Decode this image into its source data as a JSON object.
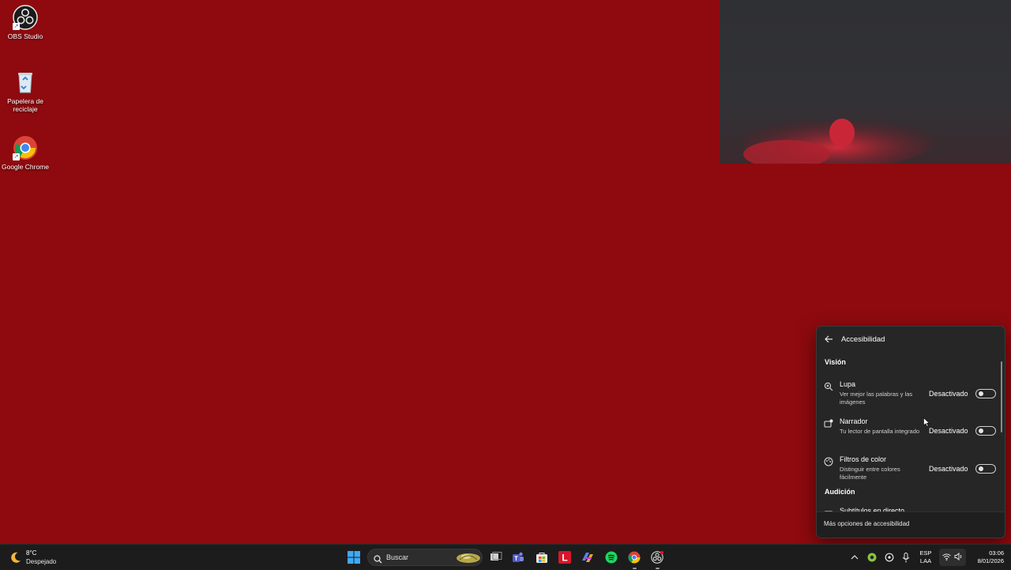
{
  "desktop": {
    "icons": [
      {
        "label": "OBS Studio",
        "icon": "obs-icon"
      },
      {
        "label": "Papelera de reciclaje",
        "icon": "recycle-bin-icon"
      },
      {
        "label": "Google Chrome",
        "icon": "chrome-icon"
      }
    ],
    "background_color": "#8e0a0e"
  },
  "flyout": {
    "title": "Accesibilidad",
    "sections": {
      "vision": "Visión",
      "audition": "Audición"
    },
    "items": [
      {
        "name": "Lupa",
        "desc": "Ver mejor las palabras y las imágenes",
        "state": "Desactivado",
        "on": false,
        "icon": "magnifier-icon"
      },
      {
        "name": "Narrador",
        "desc": "Tu lector de pantalla integrado",
        "state": "Desactivado",
        "on": false,
        "icon": "narrator-icon"
      },
      {
        "name": "Filtros de color",
        "desc": "Distinguir entre colores fácilmente",
        "state": "Desactivado",
        "on": false,
        "icon": "color-filter-icon"
      },
      {
        "name": "Subtítulos en directo",
        "icon": "captions-icon"
      }
    ],
    "footer_link": "Más opciones de accesibilidad"
  },
  "taskbar": {
    "weather": {
      "temp": "8°C",
      "condition": "Despejado"
    },
    "search_placeholder": "Buscar",
    "language": {
      "line1": "ESP",
      "line2": "LAA"
    },
    "clock": {
      "time": "03:06",
      "date": "8/01/2026"
    }
  }
}
